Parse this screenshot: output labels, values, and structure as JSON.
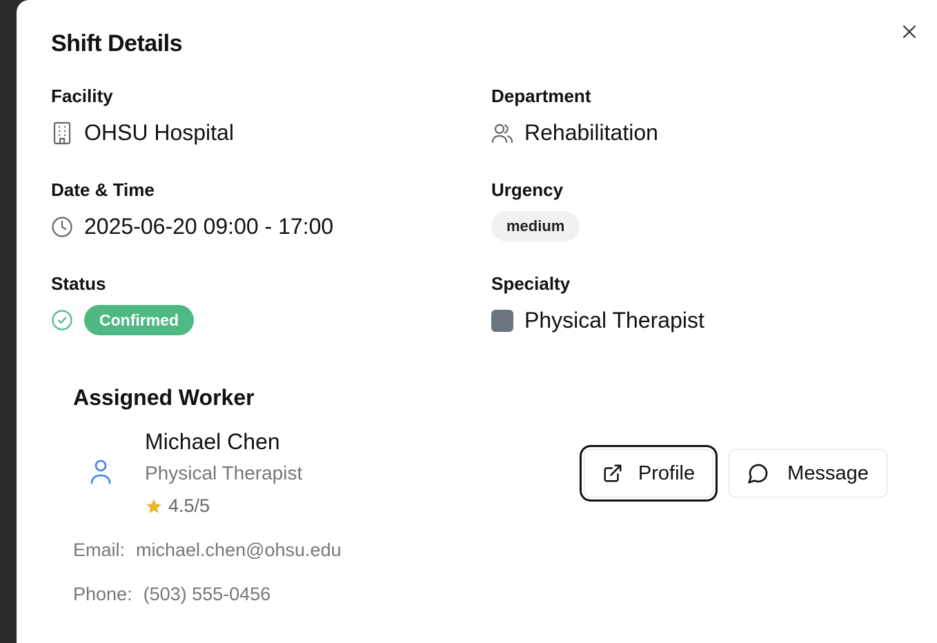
{
  "modal": {
    "title": "Shift Details"
  },
  "facility": {
    "label": "Facility",
    "value": "OHSU Hospital"
  },
  "department": {
    "label": "Department",
    "value": "Rehabilitation"
  },
  "datetime": {
    "label": "Date & Time",
    "value": "2025-06-20 09:00 - 17:00"
  },
  "urgency": {
    "label": "Urgency",
    "value": "medium"
  },
  "status": {
    "label": "Status",
    "value": "Confirmed",
    "color": "#4fb883"
  },
  "specialty": {
    "label": "Specialty",
    "value": "Physical Therapist",
    "color": "#6b7280"
  },
  "worker": {
    "section_title": "Assigned Worker",
    "name": "Michael Chen",
    "role": "Physical Therapist",
    "rating": "4.5/5",
    "email_label": "Email:",
    "email": "michael.chen@ohsu.edu",
    "phone_label": "Phone:",
    "phone": "(503) 555-0456"
  },
  "actions": {
    "profile_label": "Profile",
    "message_label": "Message"
  },
  "icons": {
    "close": "close-icon",
    "facility": "building-icon",
    "department": "users-icon",
    "datetime": "clock-icon",
    "status": "check-circle-icon",
    "rating": "star-icon",
    "avatar": "user-icon",
    "profile": "external-link-icon",
    "message": "message-circle-icon"
  },
  "colors": {
    "accent_blue": "#3b82f6",
    "star": "#e8b52c"
  }
}
